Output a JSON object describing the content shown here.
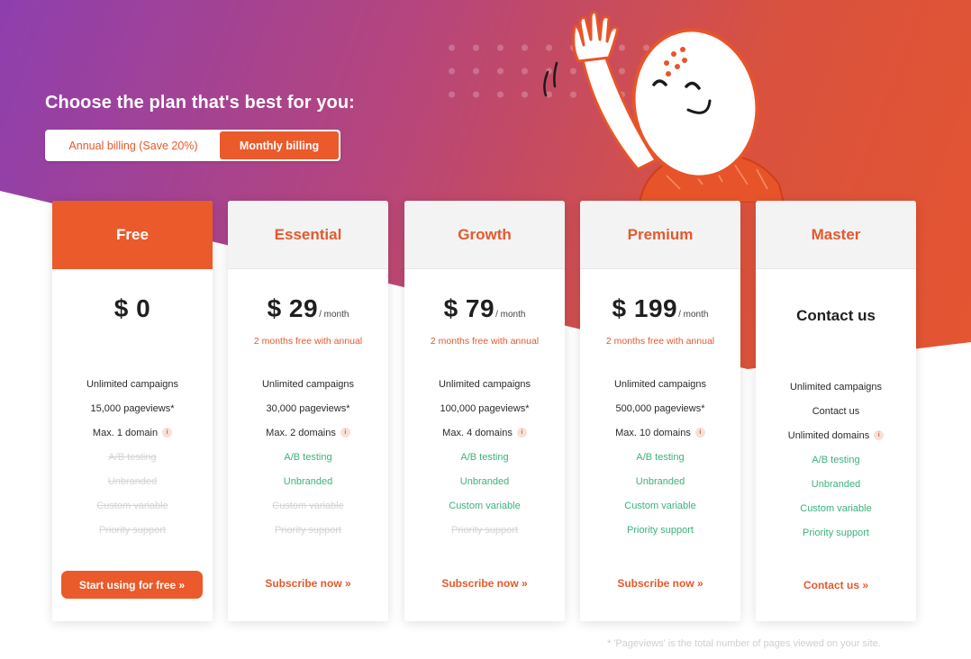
{
  "page": {
    "title": "Choose the plan that's best for you:",
    "footnote": "* 'Pageviews' is the total number of pages viewed on your site."
  },
  "billing": {
    "annual_label": "Annual billing (Save 20%)",
    "monthly_label": "Monthly billing",
    "selected": "monthly"
  },
  "colors": {
    "accent": "#ea5a2a",
    "feature_on": "#3bb27a",
    "feature_off": "#d4d4d4"
  },
  "plans": [
    {
      "name": "Free",
      "price": "$ 0",
      "per": "",
      "promo": "",
      "features": [
        "Unlimited campaigns",
        "15,000 pageviews*",
        "Max. 1 domain",
        "A/B testing",
        "Unbranded",
        "Custom variable",
        "Priority support"
      ],
      "cta": "Start using for free »"
    },
    {
      "name": "Essential",
      "price": "$ 29",
      "per": "/ month",
      "promo": "2 months free with annual",
      "features": [
        "Unlimited campaigns",
        "30,000 pageviews*",
        "Max. 2 domains",
        "A/B testing",
        "Unbranded",
        "Custom variable",
        "Priority support"
      ],
      "cta": "Subscribe now »"
    },
    {
      "name": "Growth",
      "price": "$ 79",
      "per": "/ month",
      "promo": "2 months free with annual",
      "features": [
        "Unlimited campaigns",
        "100,000 pageviews*",
        "Max. 4 domains",
        "A/B testing",
        "Unbranded",
        "Custom variable",
        "Priority support"
      ],
      "cta": "Subscribe now »"
    },
    {
      "name": "Premium",
      "price": "$ 199",
      "per": "/ month",
      "promo": "2 months free with annual",
      "features": [
        "Unlimited campaigns",
        "500,000 pageviews*",
        "Max. 10 domains",
        "A/B testing",
        "Unbranded",
        "Custom variable",
        "Priority support"
      ],
      "cta": "Subscribe now »"
    },
    {
      "name": "Master",
      "price": "Contact us",
      "per": "",
      "promo": "",
      "features": [
        "Unlimited campaigns",
        "Contact us",
        "Unlimited domains",
        "A/B testing",
        "Unbranded",
        "Custom variable",
        "Priority support"
      ],
      "cta": "Contact us »"
    }
  ]
}
